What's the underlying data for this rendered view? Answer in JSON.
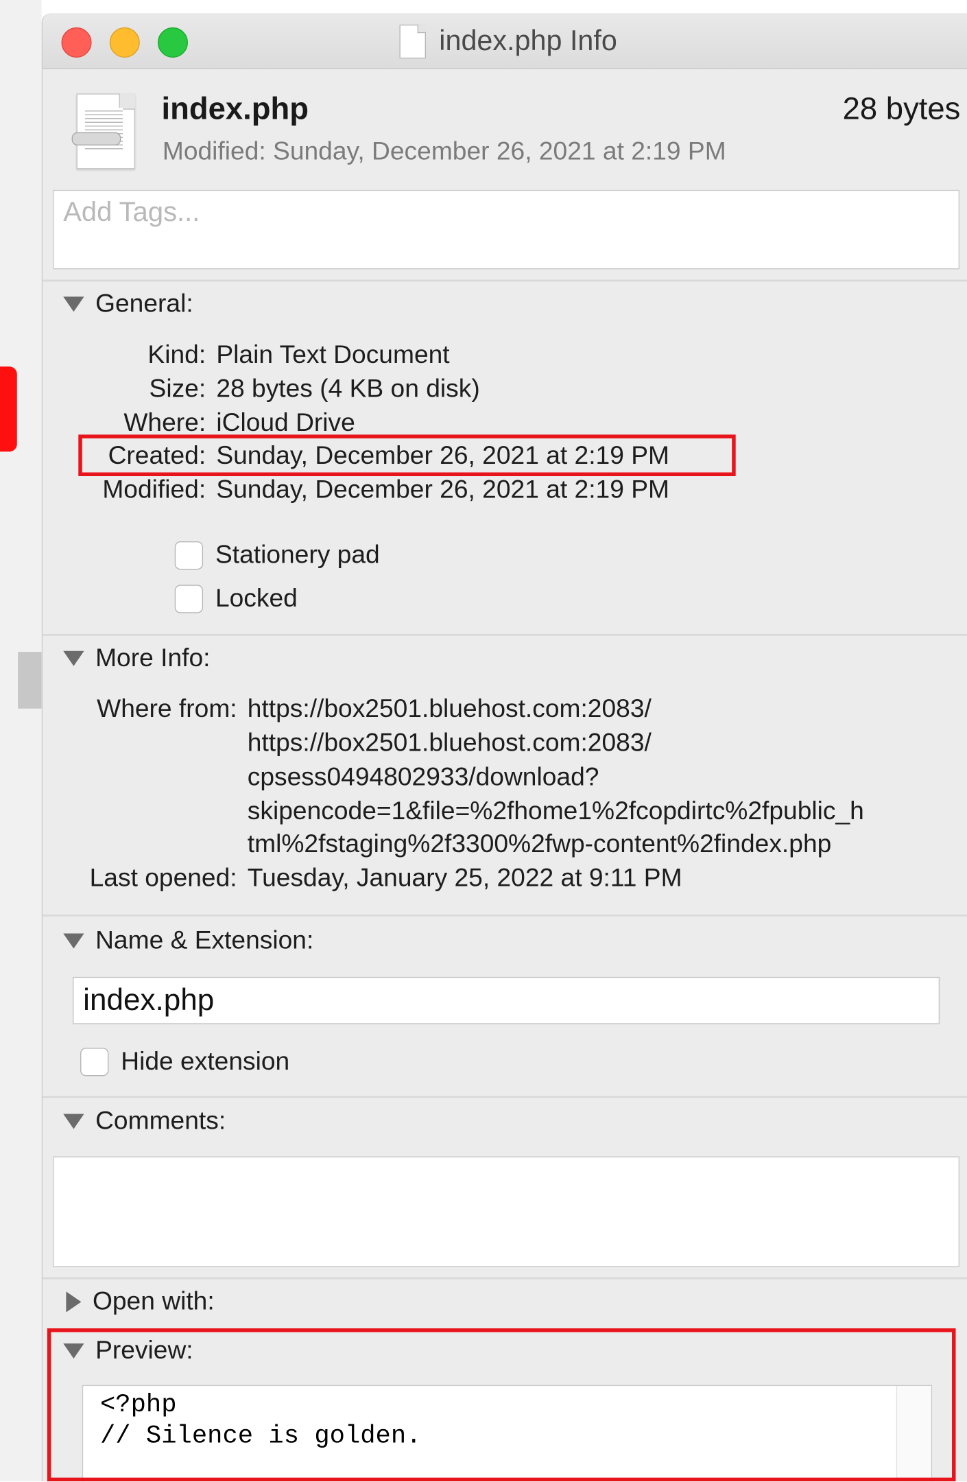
{
  "window": {
    "title": "index.php Info"
  },
  "header": {
    "file_name": "index.php",
    "size": "28 bytes",
    "modified": "Modified:  Sunday, December 26, 2021 at 2:19 PM"
  },
  "tags": {
    "placeholder": "Add Tags..."
  },
  "general": {
    "heading": "General:",
    "kind_label": "Kind:",
    "kind_value": "Plain Text Document",
    "size_label": "Size:",
    "size_value": "28 bytes (4 KB on disk)",
    "where_label": "Where:",
    "where_value": "iCloud Drive",
    "created_label": "Created:",
    "created_value": "Sunday, December 26, 2021 at 2:19 PM",
    "modified_label": "Modified:",
    "modified_value": "Sunday, December 26, 2021 at 2:19 PM",
    "stationery_label": "Stationery pad",
    "locked_label": "Locked"
  },
  "more_info": {
    "heading": "More Info:",
    "where_from_label": "Where from:",
    "where_from_lines": [
      "https://box2501.bluehost.com:2083/",
      "https://box2501.bluehost.com:2083/",
      "cpsess0494802933/download?",
      "skipencode=1&file=%2fhome1%2fcopdirtc%2fpublic_h",
      "tml%2fstaging%2f3300%2fwp-content%2findex.php"
    ],
    "last_opened_label": "Last opened:",
    "last_opened_value": "Tuesday, January 25, 2022 at 9:11 PM"
  },
  "name_extension": {
    "heading": "Name & Extension:",
    "value": "index.php",
    "hide_extension_label": "Hide extension"
  },
  "comments": {
    "heading": "Comments:"
  },
  "open_with": {
    "heading": "Open with:"
  },
  "preview": {
    "heading": "Preview:",
    "line1": "<?php",
    "line2": "// Silence is golden."
  },
  "colors": {
    "highlight": "#e8141b",
    "close": "#ff5f57",
    "minimize": "#febc2e",
    "maximize": "#28c840"
  }
}
